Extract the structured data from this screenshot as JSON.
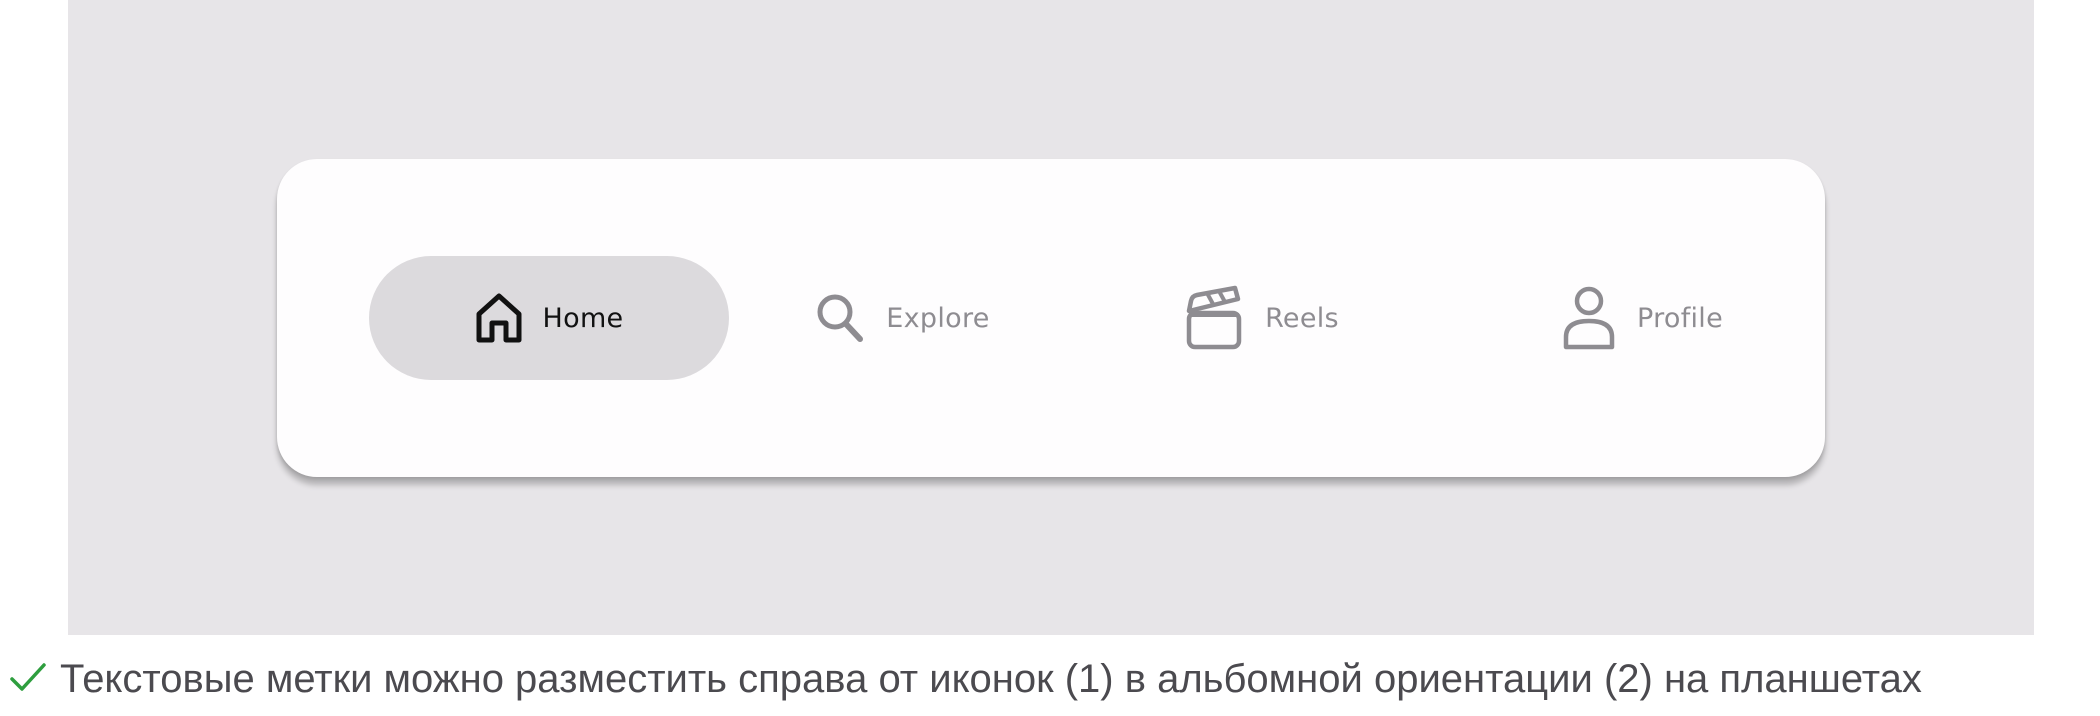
{
  "nav": {
    "items": [
      {
        "label": "Home",
        "icon": "home-icon",
        "active": true
      },
      {
        "label": "Explore",
        "icon": "search-icon",
        "active": false
      },
      {
        "label": "Reels",
        "icon": "clapperboard-icon",
        "active": false
      },
      {
        "label": "Profile",
        "icon": "person-icon",
        "active": false
      }
    ]
  },
  "caption": {
    "text": "Текстовые метки можно разместить справа от иконок (1) в альбомной ориентации (2) на планшетах",
    "icon": "checkmark-icon"
  },
  "colors": {
    "stage_background": "#e7e5e8",
    "navbar_background": "#fefdfe",
    "active_pill": "#dcdadd",
    "active_text": "#111111",
    "inactive": "#8e8c91",
    "check": "#2e9e3e",
    "caption_text": "#4b4a4f"
  }
}
